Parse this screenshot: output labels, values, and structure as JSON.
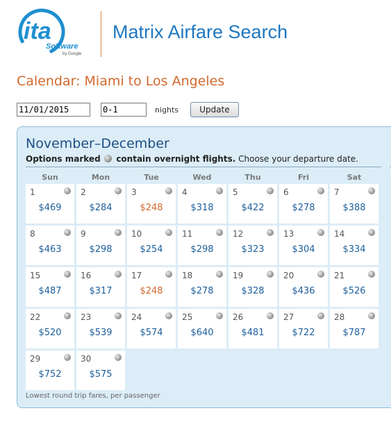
{
  "brand": {
    "logo_text": "ita",
    "logo_sub": "Software",
    "logo_by": "by Google"
  },
  "app_title": "Matrix Airfare Search",
  "page_title": "Calendar: Miami to Los Angeles",
  "form": {
    "date_value": "11/01/2015",
    "nights_value": "0-1",
    "nights_label": "nights",
    "update_label": "Update"
  },
  "calendar": {
    "range_title": "November–December",
    "legend": {
      "prefix": "Options marked",
      "suffix": "contain overnight flights.",
      "tail": "Choose your departure date."
    },
    "weekdays": [
      "Sun",
      "Mon",
      "Tue",
      "Wed",
      "Thu",
      "Fri",
      "Sat"
    ],
    "days": [
      {
        "day": "1",
        "price": "$469",
        "low": false
      },
      {
        "day": "2",
        "price": "$284",
        "low": false
      },
      {
        "day": "3",
        "price": "$248",
        "low": true
      },
      {
        "day": "4",
        "price": "$318",
        "low": false
      },
      {
        "day": "5",
        "price": "$422",
        "low": false
      },
      {
        "day": "6",
        "price": "$278",
        "low": false
      },
      {
        "day": "7",
        "price": "$388",
        "low": false
      },
      {
        "day": "8",
        "price": "$463",
        "low": false
      },
      {
        "day": "9",
        "price": "$298",
        "low": false
      },
      {
        "day": "10",
        "price": "$254",
        "low": false
      },
      {
        "day": "11",
        "price": "$298",
        "low": false
      },
      {
        "day": "12",
        "price": "$323",
        "low": false
      },
      {
        "day": "13",
        "price": "$304",
        "low": false
      },
      {
        "day": "14",
        "price": "$334",
        "low": false
      },
      {
        "day": "15",
        "price": "$487",
        "low": false
      },
      {
        "day": "16",
        "price": "$317",
        "low": false
      },
      {
        "day": "17",
        "price": "$248",
        "low": true
      },
      {
        "day": "18",
        "price": "$278",
        "low": false
      },
      {
        "day": "19",
        "price": "$328",
        "low": false
      },
      {
        "day": "20",
        "price": "$436",
        "low": false
      },
      {
        "day": "21",
        "price": "$526",
        "low": false
      },
      {
        "day": "22",
        "price": "$520",
        "low": false
      },
      {
        "day": "23",
        "price": "$539",
        "low": false
      },
      {
        "day": "24",
        "price": "$574",
        "low": false
      },
      {
        "day": "25",
        "price": "$640",
        "low": false
      },
      {
        "day": "26",
        "price": "$481",
        "low": false
      },
      {
        "day": "27",
        "price": "$722",
        "low": false
      },
      {
        "day": "28",
        "price": "$787",
        "low": false
      },
      {
        "day": "29",
        "price": "$752",
        "low": false
      },
      {
        "day": "30",
        "price": "$575",
        "low": false
      }
    ],
    "footnote": "Lowest round trip fares, per passenger"
  },
  "colors": {
    "accent_blue": "#1f77c0",
    "title_orange": "#d2692d",
    "price_blue": "#1d5f9a",
    "price_low": "#d2692d",
    "panel_bg": "#dcedf7"
  },
  "icons": {
    "overnight": "overnight-indicator-icon"
  }
}
